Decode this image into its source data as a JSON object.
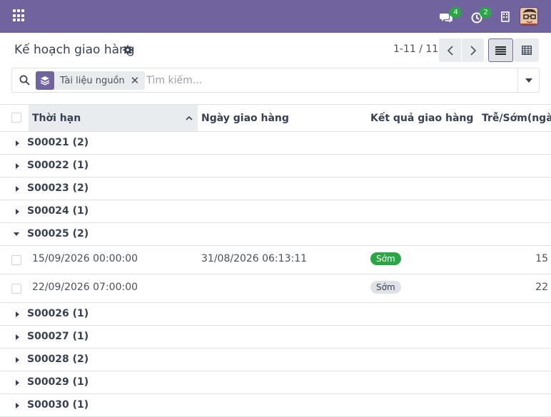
{
  "navbar": {
    "messages_count": "4",
    "activities_count": "2",
    "colors": {
      "bg": "#71639e",
      "badge": "#28a745"
    }
  },
  "control_panel": {
    "title": "Kế hoạch giao hàng",
    "pager": "1-11 / 11"
  },
  "search": {
    "facet_label": "Tài liệu nguồn",
    "placeholder": "Tìm kiếm..."
  },
  "table": {
    "columns": [
      "Thời hạn",
      "Ngày giao hàng",
      "Kết quả giao hàng",
      "Trễ/Sớm(ngày)"
    ],
    "groups": [
      {
        "label": "S00021 (2)",
        "expanded": false
      },
      {
        "label": "S00022 (1)",
        "expanded": false
      },
      {
        "label": "S00023 (2)",
        "expanded": false
      },
      {
        "label": "S00024 (1)",
        "expanded": false
      },
      {
        "label": "S00025 (2)",
        "expanded": true
      },
      {
        "label": "S00026 (1)",
        "expanded": false
      },
      {
        "label": "S00027 (1)",
        "expanded": false
      },
      {
        "label": "S00028 (2)",
        "expanded": false
      },
      {
        "label": "S00029 (1)",
        "expanded": false
      },
      {
        "label": "S00030 (1)",
        "expanded": false
      }
    ],
    "records": [
      {
        "deadline": "15/09/2026 00:00:00",
        "delivery_date": "31/08/2026 06:13:11",
        "result": "Sớm",
        "result_style": "green",
        "days": "15"
      },
      {
        "deadline": "22/09/2026 07:00:00",
        "delivery_date": "",
        "result": "Sớm",
        "result_style": "grey",
        "days": "22"
      }
    ]
  }
}
